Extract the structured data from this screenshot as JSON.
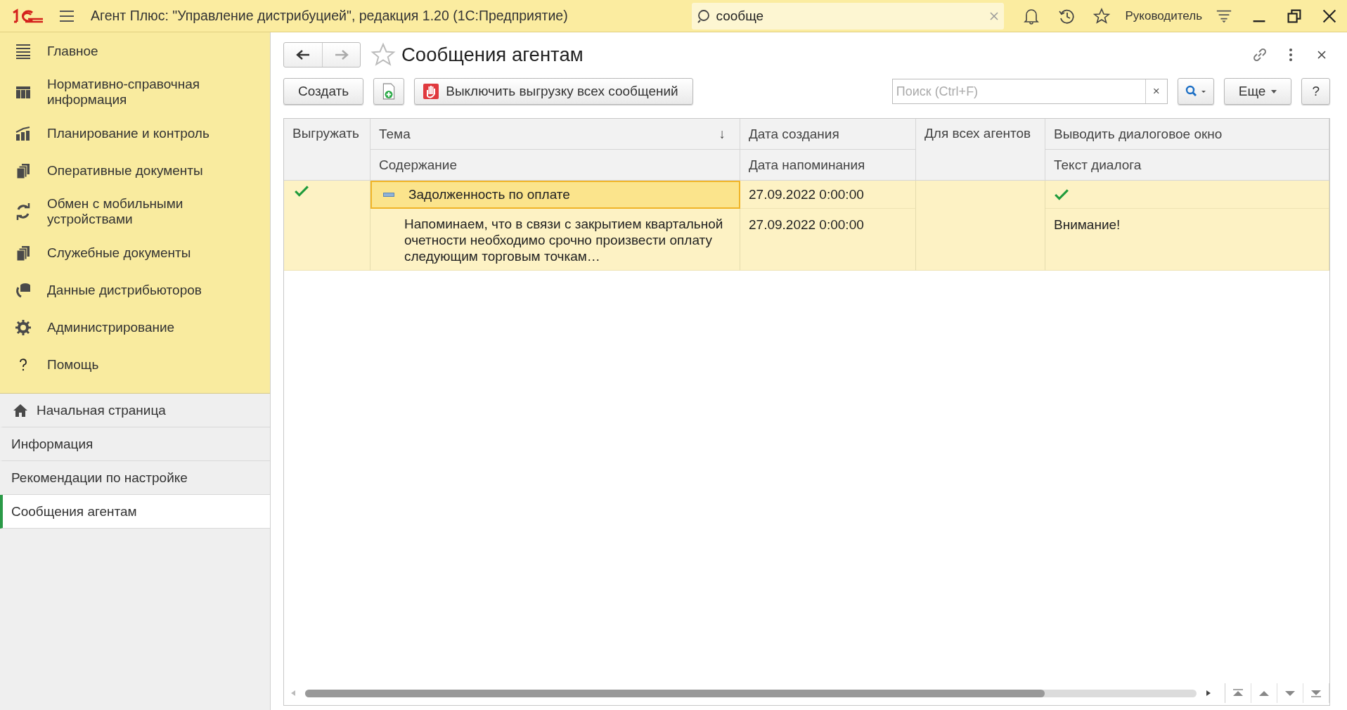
{
  "app_bar": {
    "title": "Агент Плюс: \"Управление дистрибуцией\", редакция 1.20  (1С:Предприятие)",
    "search": {
      "value": "сообще"
    },
    "user": "Руководитель"
  },
  "sections": [
    {
      "label": "Главное"
    },
    {
      "label": "Нормативно-справочная информация"
    },
    {
      "label": "Планирование и контроль"
    },
    {
      "label": "Оперативные документы"
    },
    {
      "label": "Обмен с мобильными устройствами"
    },
    {
      "label": "Служебные документы"
    },
    {
      "label": "Данные дистрибьюторов"
    },
    {
      "label": "Администрирование"
    },
    {
      "label": "Помощь"
    }
  ],
  "open_pages": [
    {
      "label": "Начальная страница",
      "kind": "home",
      "selected": false
    },
    {
      "label": "Информация",
      "kind": "page",
      "selected": false
    },
    {
      "label": "Рекомендации по настройке",
      "kind": "page",
      "selected": false
    },
    {
      "label": "Сообщения агентам",
      "kind": "page",
      "selected": true
    }
  ],
  "form": {
    "title": "Сообщения агентам",
    "create_button": "Создать",
    "disable_button": "Выключить выгрузку всех сообщений",
    "search": {
      "placeholder": "Поиск (Ctrl+F)"
    },
    "clear_mark": "×",
    "more_button": "Еще",
    "help_button": "?"
  },
  "table": {
    "columns": {
      "export": "Выгружать",
      "topic": "Тема",
      "topic_sort_mark": "↓",
      "created": "Дата создания",
      "for_all_agents": "Для всех агентов",
      "show_dialog": "Выводить диалоговое окно",
      "content": "Содержание",
      "reminder": "Дата напоминания",
      "dialog_text": "Текст диалога"
    },
    "rows": [
      {
        "selected": true,
        "export": true,
        "topic": "Задолженность по оплате",
        "created": "27.09.2022 0:00:00",
        "for_all_agents": false,
        "show_dialog": true,
        "content": "Напоминаем, что в связи с закрытием квартальной очетности необходимо срочно произвести оплату следующим торговым точкам…",
        "reminder": "27.09.2022 0:00:00",
        "dialog_text": "Внимание!"
      }
    ]
  }
}
